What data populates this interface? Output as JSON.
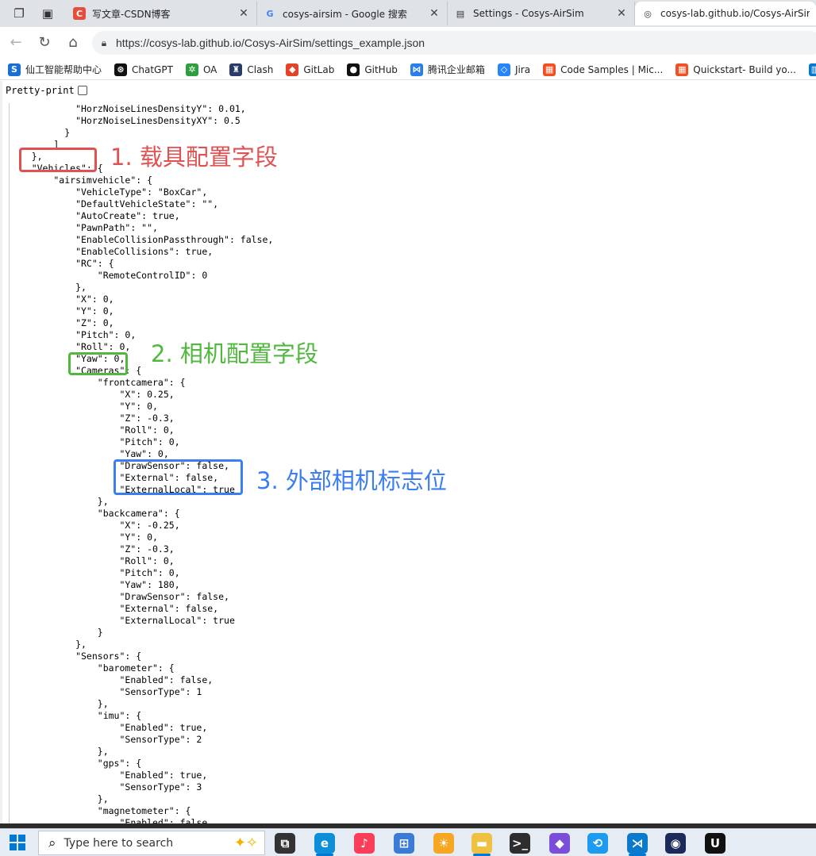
{
  "tabs": [
    {
      "title": "写文章-CSDN博客",
      "icon": "csdn-icon",
      "color": "#e74c3c",
      "glyph": "C"
    },
    {
      "title": "cosys-airsim - Google 搜索",
      "icon": "google-icon",
      "color": "#4285f4",
      "glyph": "G"
    },
    {
      "title": "Settings - Cosys-AirSim",
      "icon": "book-icon",
      "color": "#333333",
      "glyph": "▤"
    },
    {
      "title": "cosys-lab.github.io/Cosys-AirSim/",
      "icon": "globe-icon",
      "color": "#333333",
      "glyph": "◎"
    }
  ],
  "address": {
    "url": "https://cosys-lab.github.io/Cosys-AirSim/settings_example.json"
  },
  "bookmarks": [
    {
      "label": "仙工智能帮助中心",
      "icon": "seer-icon",
      "color": "#1a6fd6",
      "glyph": "S"
    },
    {
      "label": "ChatGPT",
      "icon": "chatgpt-icon",
      "color": "#111111",
      "glyph": "⊛"
    },
    {
      "label": "OA",
      "icon": "oa-icon",
      "color": "#2e9e3e",
      "glyph": "✲"
    },
    {
      "label": "Clash",
      "icon": "clash-icon",
      "color": "#2a3a6a",
      "glyph": "♜"
    },
    {
      "label": "GitLab",
      "icon": "gitlab-icon",
      "color": "#e24329",
      "glyph": "◆"
    },
    {
      "label": "GitHub",
      "icon": "github-icon",
      "color": "#111111",
      "glyph": "●"
    },
    {
      "label": "腾讯企业邮箱",
      "icon": "tencent-mail-icon",
      "color": "#2b7de9",
      "glyph": "⋈"
    },
    {
      "label": "Jira",
      "icon": "jira-icon",
      "color": "#2684ff",
      "glyph": "◇"
    },
    {
      "label": "Code Samples | Mic...",
      "icon": "microsoft-icon",
      "color": "#f25022",
      "glyph": "▦"
    },
    {
      "label": "Quickstart- Build yo...",
      "icon": "microsoft-icon",
      "color": "#f25022",
      "glyph": "▦"
    },
    {
      "label": "Create",
      "icon": "azure-icon",
      "color": "#0078d4",
      "glyph": "▥"
    }
  ],
  "pretty_print_label": "Pretty-print",
  "json_lines": [
    "            \"HorzNoiseLinesDensityY\": 0.01,",
    "            \"HorzNoiseLinesDensityXY\": 0.5",
    "          }",
    "        ]",
    "    },",
    "    \"Vehicles\": {",
    "        \"airsimvehicle\": {",
    "            \"VehicleType\": \"BoxCar\",",
    "            \"DefaultVehicleState\": \"\",",
    "            \"AutoCreate\": true,",
    "            \"PawnPath\": \"\",",
    "            \"EnableCollisionPassthrough\": false,",
    "            \"EnableCollisions\": true,",
    "            \"RC\": {",
    "                \"RemoteControlID\": 0",
    "            },",
    "            \"X\": 0,",
    "            \"Y\": 0,",
    "            \"Z\": 0,",
    "            \"Pitch\": 0,",
    "            \"Roll\": 0,",
    "            \"Yaw\": 0,",
    "            \"Cameras\": {",
    "                \"frontcamera\": {",
    "                    \"X\": 0.25,",
    "                    \"Y\": 0,",
    "                    \"Z\": -0.3,",
    "                    \"Roll\": 0,",
    "                    \"Pitch\": 0,",
    "                    \"Yaw\": 0,",
    "                    \"DrawSensor\": false,",
    "                    \"External\": false,",
    "                    \"ExternalLocal\": true",
    "                },",
    "                \"backcamera\": {",
    "                    \"X\": -0.25,",
    "                    \"Y\": 0,",
    "                    \"Z\": -0.3,",
    "                    \"Roll\": 0,",
    "                    \"Pitch\": 0,",
    "                    \"Yaw\": 180,",
    "                    \"DrawSensor\": false,",
    "                    \"External\": false,",
    "                    \"ExternalLocal\": true",
    "                }",
    "            },",
    "            \"Sensors\": {",
    "                \"barometer\": {",
    "                    \"Enabled\": false,",
    "                    \"SensorType\": 1",
    "                },",
    "                \"imu\": {",
    "                    \"Enabled\": true,",
    "                    \"SensorType\": 2",
    "                },",
    "                \"gps\": {",
    "                    \"Enabled\": true,",
    "                    \"SensorType\": 3",
    "                },",
    "                \"magnetometer\": {",
    "                    \"Enabled\": false,"
  ],
  "callouts": [
    {
      "label": "1. 载具配置字段",
      "color": "#e05252"
    },
    {
      "label": "2. 相机配置字段",
      "color": "#4fb83d"
    },
    {
      "label": "3. 外部相机标志位",
      "color": "#3b7ef0"
    }
  ],
  "taskbar": {
    "search_placeholder": "Type here to search",
    "apps": [
      {
        "icon": "task-view-icon",
        "color": "#333333",
        "glyph": "⧉"
      },
      {
        "icon": "edge-icon",
        "color": "#0c8fd8",
        "glyph": "e"
      },
      {
        "icon": "music-icon",
        "color": "#fa3d59",
        "glyph": "♪"
      },
      {
        "icon": "store-icon",
        "color": "#3a7bd5",
        "glyph": "⊞"
      },
      {
        "icon": "weather-icon",
        "color": "#f5a623",
        "glyph": "☀"
      },
      {
        "icon": "file-explorer-icon",
        "color": "#f0c040",
        "glyph": "▬"
      },
      {
        "icon": "terminal-icon",
        "color": "#2d2d2d",
        "glyph": ">_"
      },
      {
        "icon": "obsidian-icon",
        "color": "#7a4ed8",
        "glyph": "◆"
      },
      {
        "icon": "sync-icon",
        "color": "#1d9bf0",
        "glyph": "⟲"
      },
      {
        "icon": "vscode-icon",
        "color": "#0a7acc",
        "glyph": "⋊"
      },
      {
        "icon": "app-icon",
        "color": "#1c2a5a",
        "glyph": "◉"
      },
      {
        "icon": "unreal-icon",
        "color": "#111111",
        "glyph": "U"
      }
    ]
  }
}
